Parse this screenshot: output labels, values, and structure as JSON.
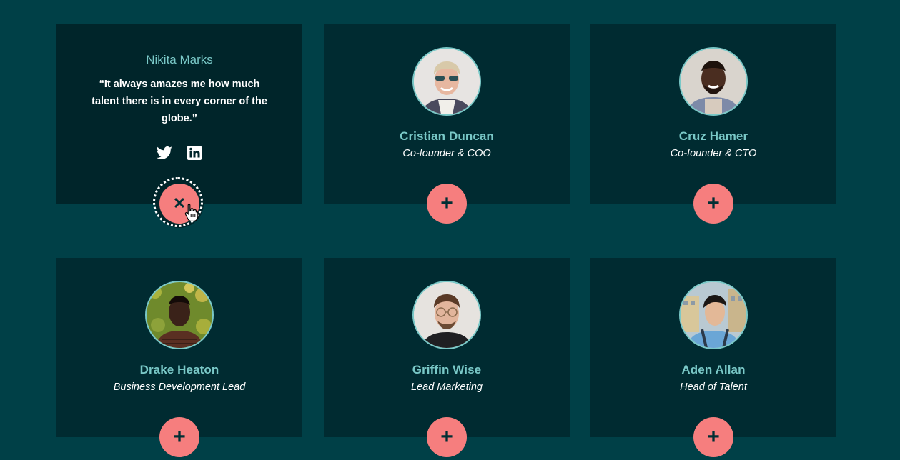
{
  "featured": {
    "name": "Nikita Marks",
    "quote": "“It always amazes me how much talent there is in every corner of the globe.”",
    "socials": [
      "twitter-icon",
      "linkedin-icon"
    ],
    "toggle_icon": "close-icon",
    "toggle_glyph": "✕"
  },
  "team": [
    {
      "name": "Cristian Duncan",
      "role": "Co-founder & COO",
      "toggle_glyph": "+"
    },
    {
      "name": "Cruz Hamer",
      "role": "Co-founder & CTO",
      "toggle_glyph": "+"
    },
    {
      "name": "Drake Heaton",
      "role": "Business Development Lead",
      "toggle_glyph": "+"
    },
    {
      "name": "Griffin Wise",
      "role": "Lead Marketing",
      "toggle_glyph": "+"
    },
    {
      "name": "Aden Allan",
      "role": "Head of Talent",
      "toggle_glyph": "+"
    }
  ],
  "colors": {
    "background": "#004047",
    "card": "#002b31",
    "accent_teal": "#79c8c7",
    "accent_coral": "#f67e7e"
  }
}
